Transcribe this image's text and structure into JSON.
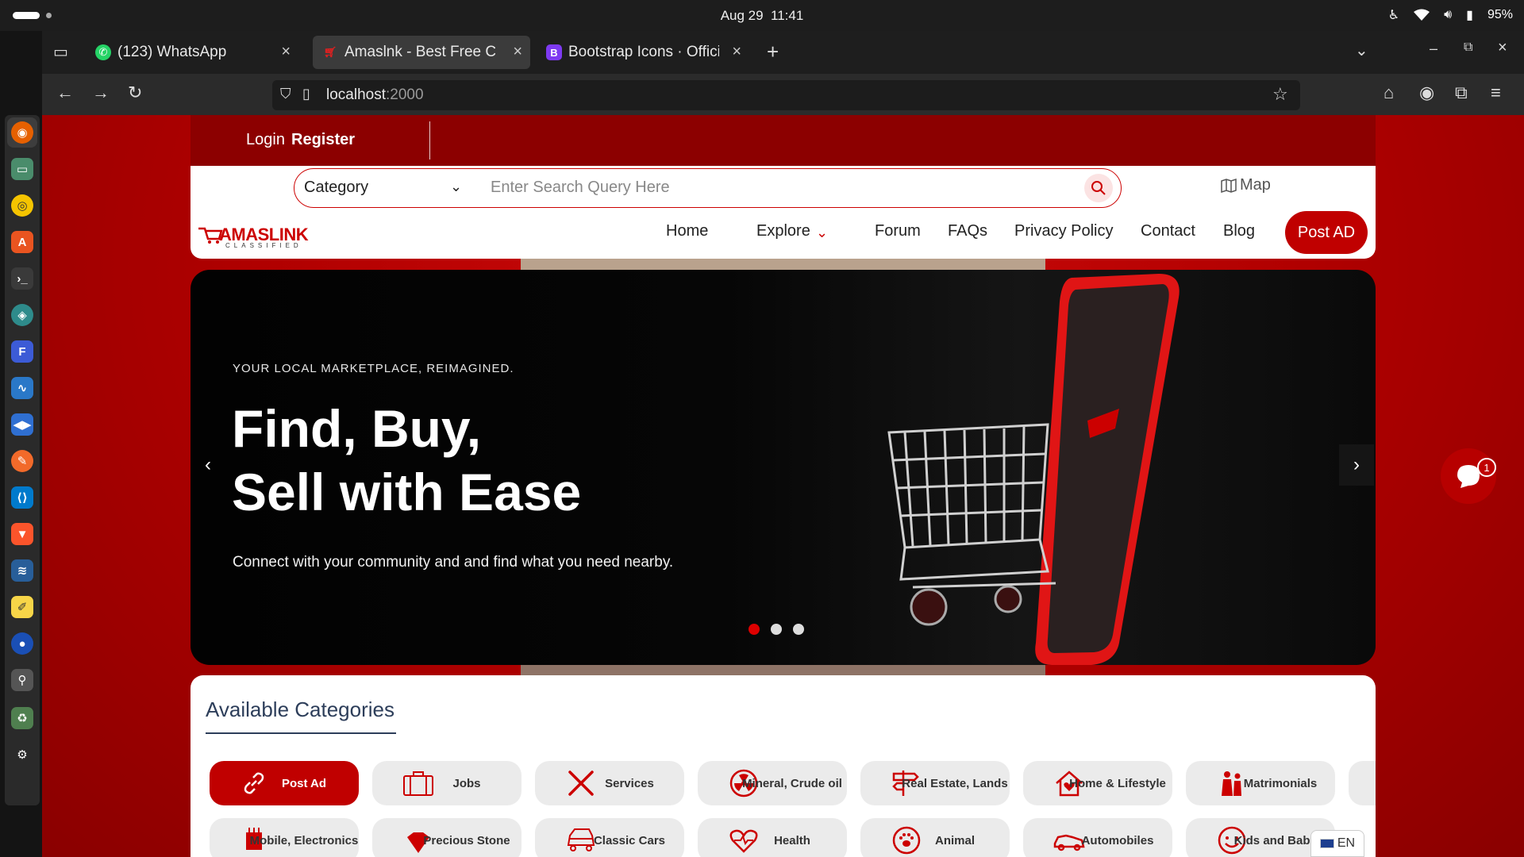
{
  "os": {
    "date": "Aug 29",
    "time": "11:41",
    "battery": "95%"
  },
  "tabs": [
    {
      "label": "(123) WhatsApp"
    },
    {
      "label": "Amaslnk - Best Free Classifieds"
    },
    {
      "label": "Bootstrap Icons · Official open source SVG icon library for Bootstrap"
    }
  ],
  "address": {
    "host": "localhost",
    "port": ":2000"
  },
  "site": {
    "login": "Login",
    "register": "Register",
    "category_select": "Category",
    "search_placeholder": "Enter Search Query Here",
    "map": "Map",
    "logo_main": "AMASLINK",
    "logo_sub": "CLASSIFIED",
    "menu": [
      "Home",
      "Explore",
      "Forum",
      "FAQs",
      "Privacy Policy",
      "Contact",
      "Blog"
    ],
    "post_ad": "Post AD"
  },
  "hero": {
    "kicker": "YOUR LOCAL MARKETPLACE, REIMAGINED.",
    "line1": "Find, Buy,",
    "line2": "Sell with Ease",
    "subtitle": "Connect with your community and and find what you need nearby.",
    "slide_count": 3,
    "active_slide": 1
  },
  "chat": {
    "badge": "1"
  },
  "categories": {
    "title": "Available Categories",
    "row1": [
      "Post Ad",
      "Jobs",
      "Services",
      "Mineral, Crude oil",
      "Real Estate, Lands",
      "Home & Lifestyle",
      "Matrimonials"
    ],
    "row2": [
      "Mobile, Electronics",
      "Precious Stone",
      "Classic Cars",
      "Health",
      "Animal",
      "Automobiles",
      "Kids and Babies"
    ]
  },
  "language": "EN",
  "colors": {
    "brand": "#c00000",
    "title": "#2d3e5a"
  }
}
